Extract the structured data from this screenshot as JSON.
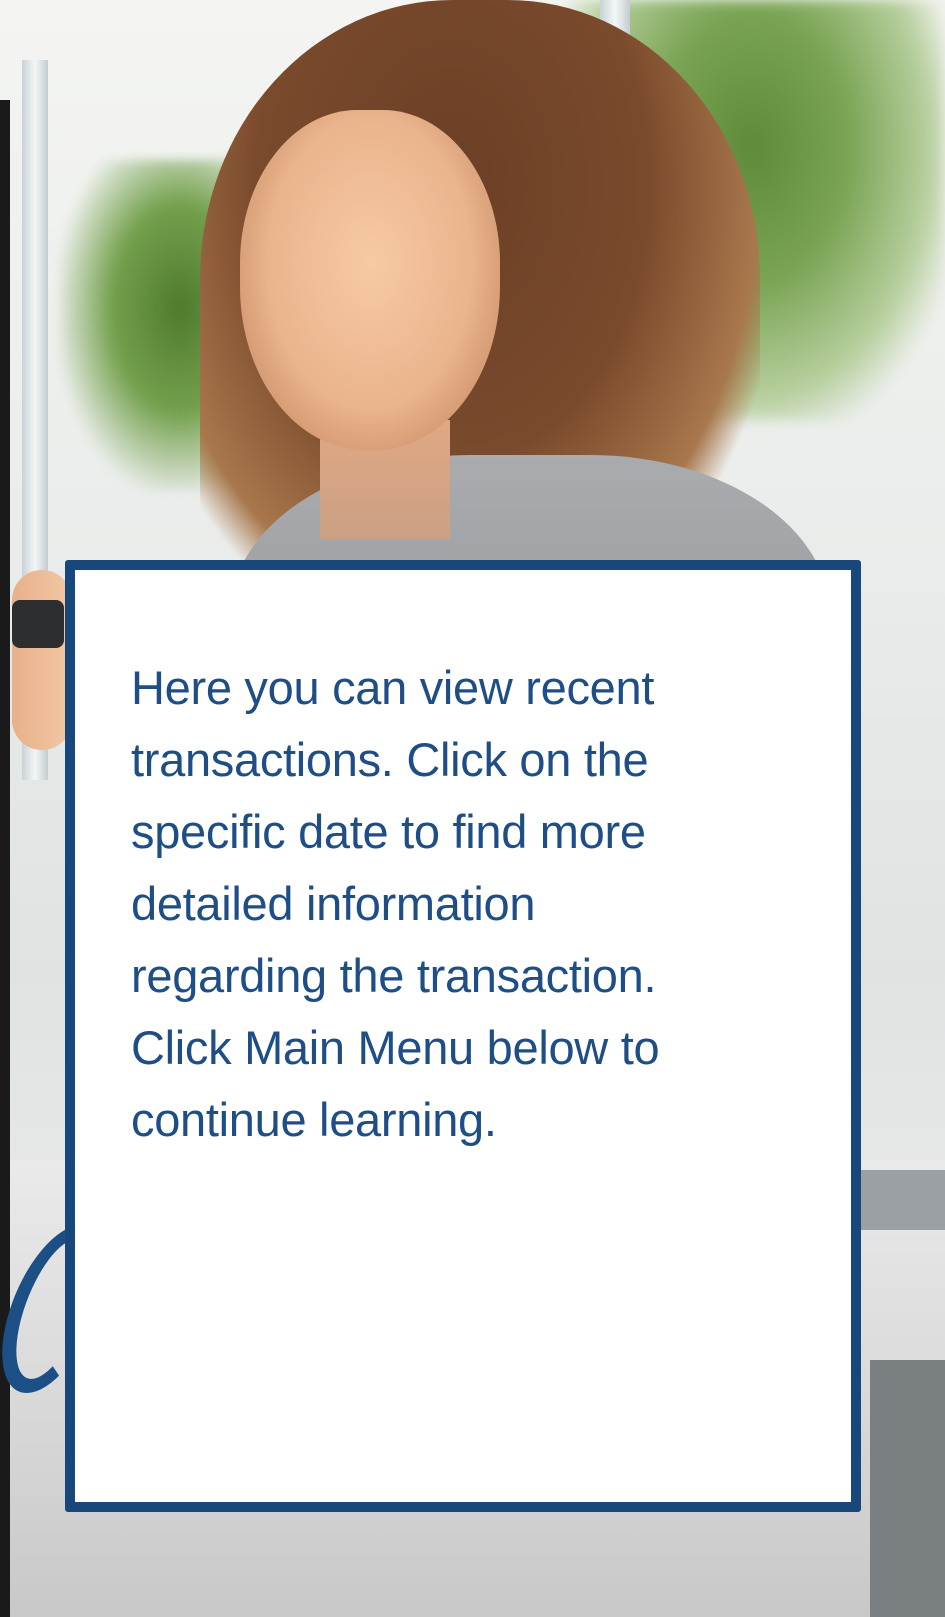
{
  "tutorial": {
    "lines": [
      "Here you can view recent",
      "transactions.  Click on the",
      "specific date to find more",
      "detailed information",
      "regarding the transaction.",
      "Click Main Menu below to",
      "continue learning."
    ]
  },
  "colors": {
    "box_border": "#17477b",
    "text": "#1f4e86"
  },
  "icons": {
    "phone": "phone-icon"
  }
}
